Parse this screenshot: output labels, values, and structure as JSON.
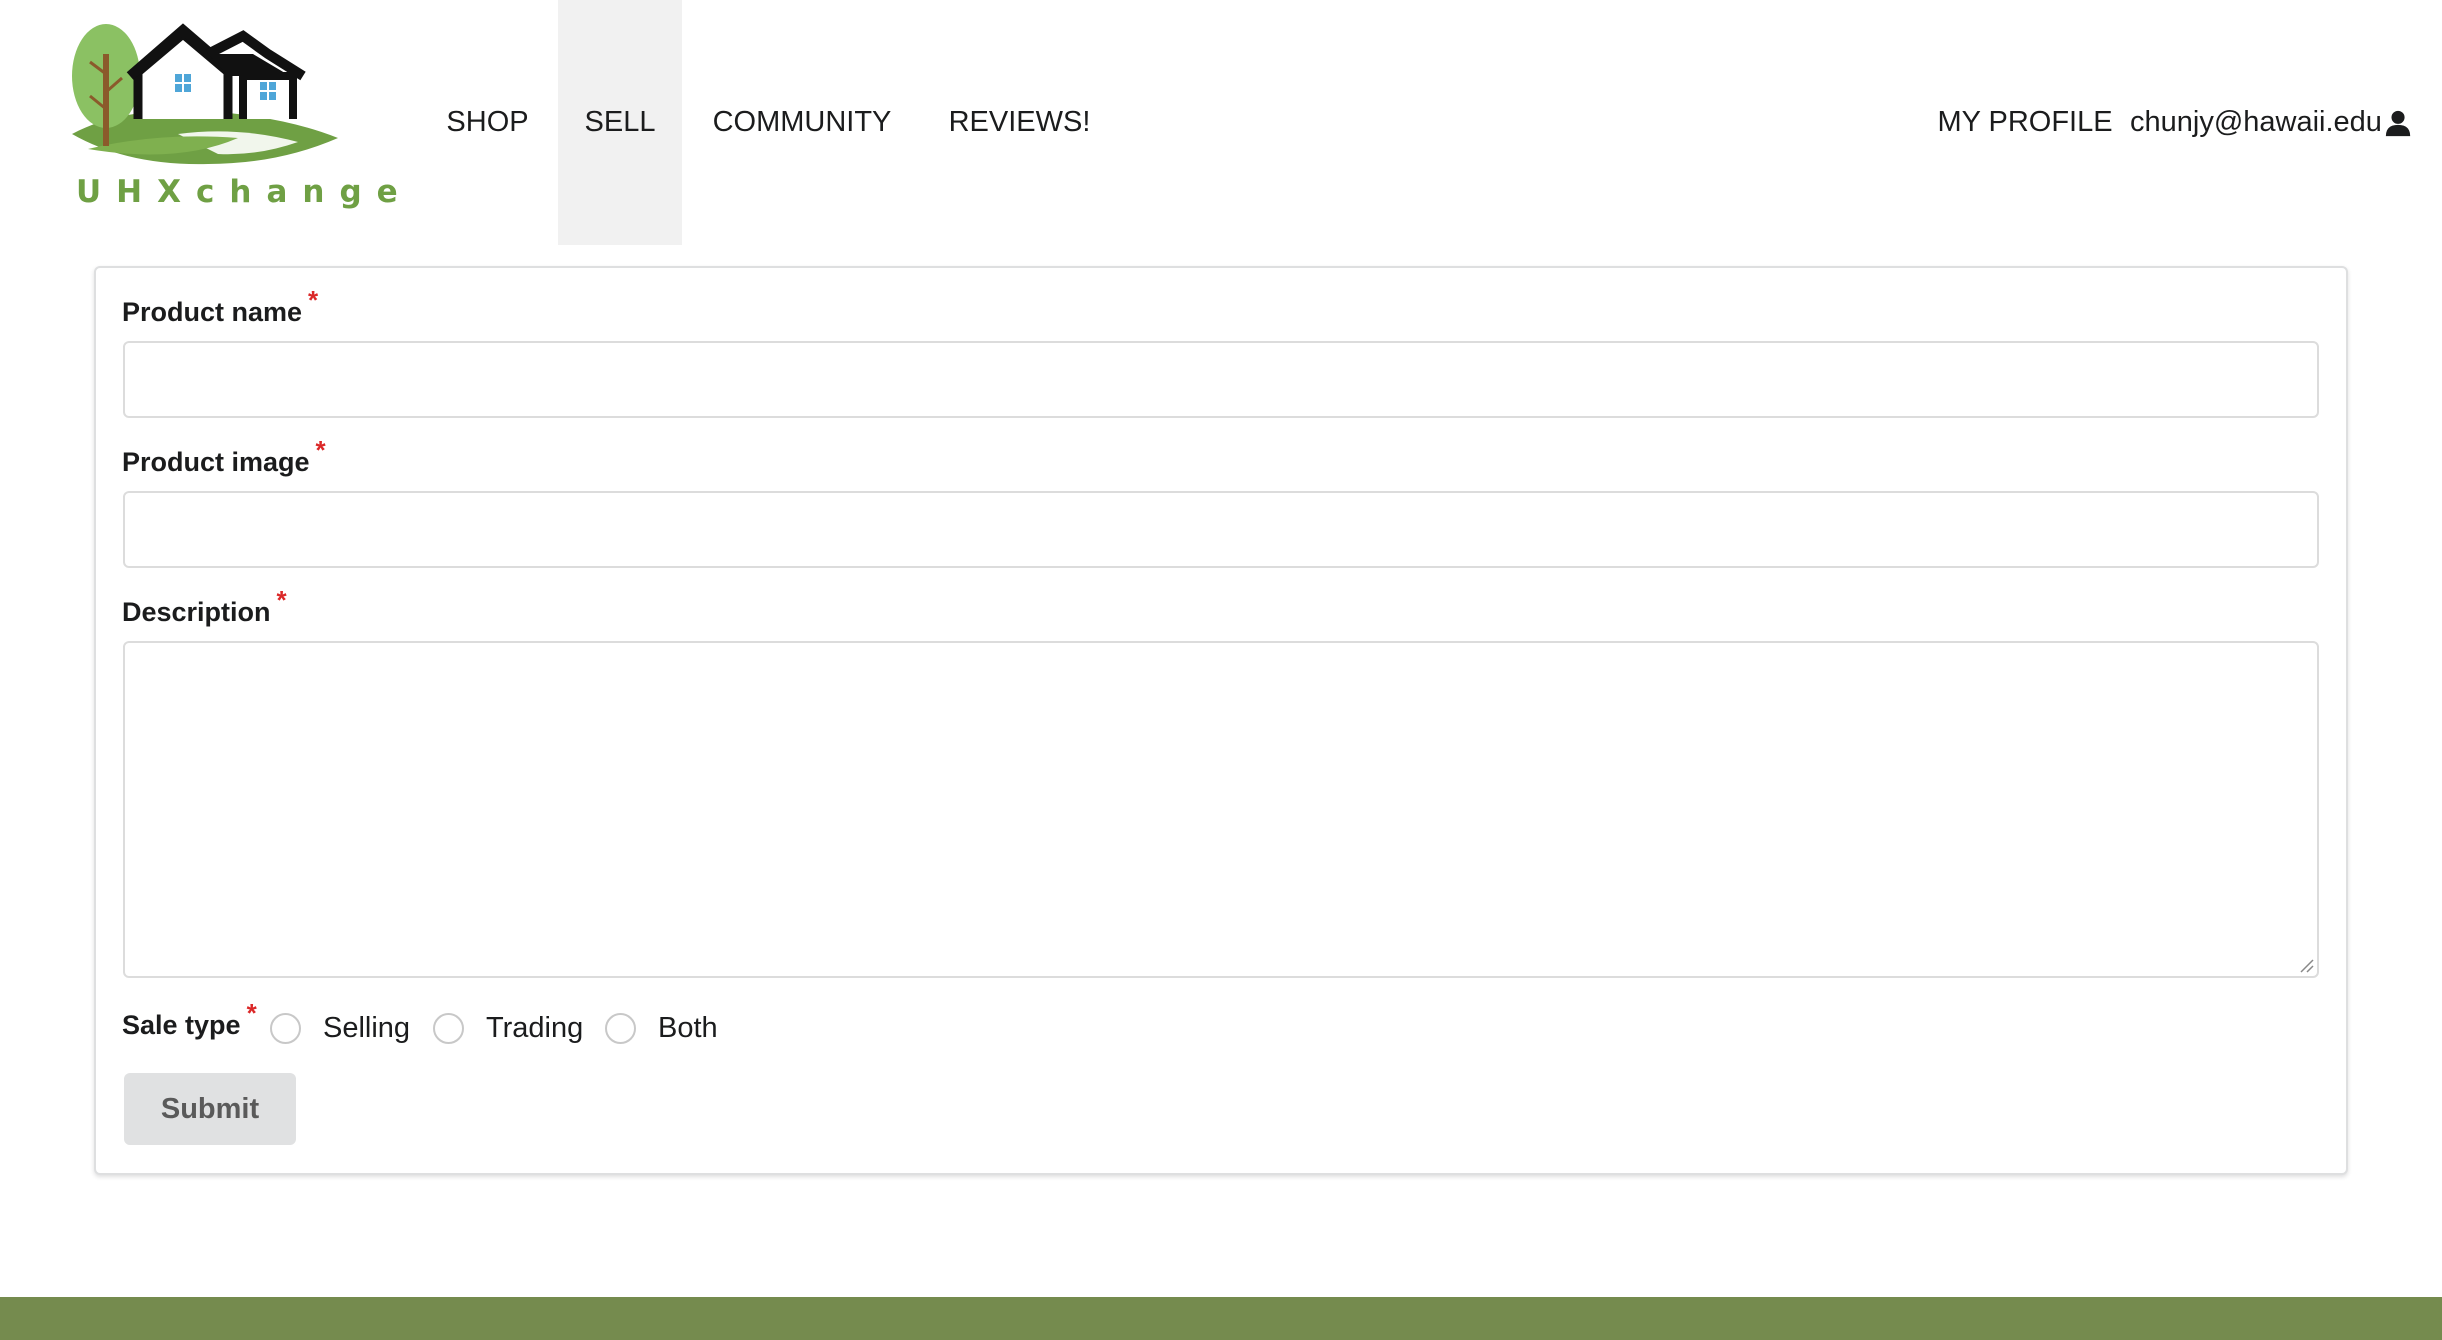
{
  "brand": {
    "logo_text": "UHXchange",
    "colors": {
      "leaf_green": "#8bc163",
      "grass_green": "#6fa044",
      "house_black": "#111111",
      "window_blue": "#4fa6d8",
      "trunk_brown": "#8b5a2b"
    }
  },
  "nav": {
    "items": [
      {
        "label": "SHOP",
        "active": false
      },
      {
        "label": "SELL",
        "active": true
      },
      {
        "label": "COMMUNITY",
        "active": false
      },
      {
        "label": "REVIEWS!",
        "active": false
      }
    ],
    "right": {
      "profile_label": "MY PROFILE",
      "user_email": "chunjy@hawaii.edu",
      "user_icon": "user-icon"
    }
  },
  "form": {
    "product_name": {
      "label": "Product name",
      "required_mark": "*",
      "value": "",
      "placeholder": ""
    },
    "product_image": {
      "label": "Product image",
      "required_mark": "*",
      "value": "",
      "placeholder": ""
    },
    "description": {
      "label": "Description",
      "required_mark": "*",
      "value": "",
      "placeholder": ""
    },
    "sale_type": {
      "label": "Sale type",
      "required_mark": "*",
      "options": [
        "Selling",
        "Trading",
        "Both"
      ],
      "selected": null
    },
    "submit_label": "Submit"
  },
  "colors": {
    "active_nav_bg": "#f1f1f1",
    "required_red": "#db2828",
    "button_bg": "#e0e1e2",
    "footer_green": "#758b4e"
  }
}
